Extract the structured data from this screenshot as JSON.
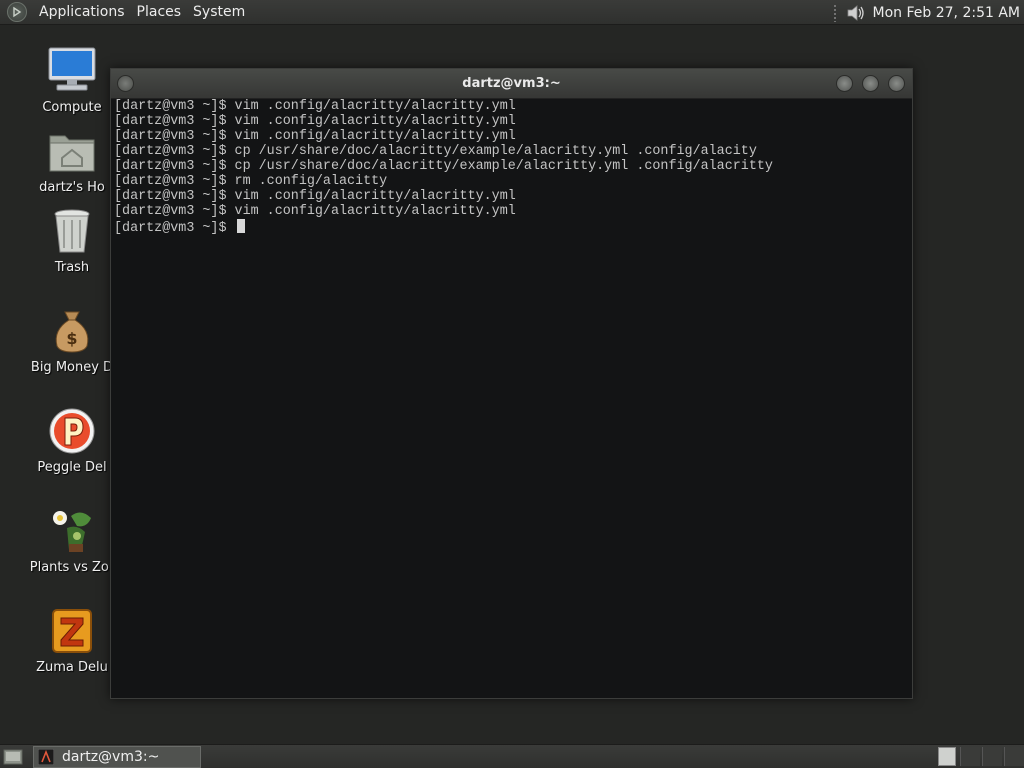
{
  "top_panel": {
    "menus": [
      "Applications",
      "Places",
      "System"
    ],
    "clock": "Mon Feb 27,  2:51 AM",
    "icons": {
      "logo": "gnome-foot-icon",
      "volume": "volume-icon"
    }
  },
  "desktop": {
    "icons": [
      {
        "label": "Compute",
        "icon": "computer-icon"
      },
      {
        "label": "dartz's Ho",
        "icon": "home-folder-icon"
      },
      {
        "label": "Trash",
        "icon": "trash-icon"
      },
      {
        "label": "Big Money D",
        "icon": "money-bag-icon"
      },
      {
        "label": "Peggle Del",
        "icon": "peggle-icon"
      },
      {
        "label": "Plants vs Zor",
        "icon": "plants-vs-zombies-icon"
      },
      {
        "label": "Zuma Delu",
        "icon": "zuma-icon"
      }
    ]
  },
  "terminal": {
    "title": "dartz@vm3:~",
    "lines": [
      "[dartz@vm3 ~]$ vim .config/alacritty/alacritty.yml",
      "[dartz@vm3 ~]$ vim .config/alacritty/alacritty.yml",
      "[dartz@vm3 ~]$ vim .config/alacritty/alacritty.yml",
      "[dartz@vm3 ~]$ cp /usr/share/doc/alacritty/example/alacritty.yml .config/alacity",
      "[dartz@vm3 ~]$ cp /usr/share/doc/alacritty/example/alacritty.yml .config/alacritty",
      "[dartz@vm3 ~]$ rm .config/alacitty",
      "[dartz@vm3 ~]$ vim .config/alacritty/alacritty.yml",
      "[dartz@vm3 ~]$ vim .config/alacritty/alacritty.yml"
    ],
    "prompt": "[dartz@vm3 ~]$ "
  },
  "bottom_panel": {
    "task_label": "dartz@vm3:~",
    "icons": {
      "show_desktop": "show-desktop-icon",
      "task": "alacritty-icon"
    }
  },
  "colors": {
    "desktop_bg": "#252624",
    "panel_bg": "#353634",
    "terminal_bg": "#131415",
    "terminal_fg": "#c4c4c4"
  }
}
